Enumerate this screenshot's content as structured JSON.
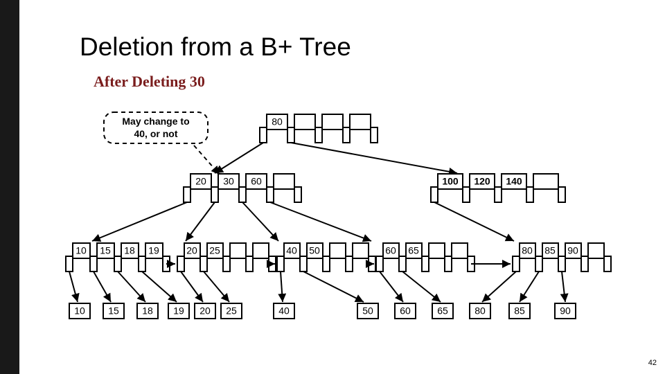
{
  "title": "Deletion from a B+ Tree",
  "subtitle": "After Deleting 30",
  "page_number": "42",
  "callout": {
    "line1": "May change to",
    "line2": "40, or not"
  },
  "root": {
    "keys": [
      "80",
      "",
      "",
      ""
    ]
  },
  "internal_left": {
    "keys": [
      "20",
      "30",
      "60",
      ""
    ]
  },
  "internal_right": {
    "keys": [
      "100",
      "120",
      "140",
      ""
    ]
  },
  "leaves": [
    {
      "keys": [
        "10",
        "15",
        "18",
        "19"
      ]
    },
    {
      "keys": [
        "20",
        "25",
        "",
        ""
      ]
    },
    {
      "keys": [
        "40",
        "50",
        "",
        ""
      ]
    },
    {
      "keys": [
        "60",
        "65",
        "",
        ""
      ]
    },
    {
      "keys": [
        "80",
        "85",
        "90",
        ""
      ]
    }
  ],
  "records": [
    "10",
    "15",
    "18",
    "19",
    "20",
    "25",
    "40",
    "50",
    "60",
    "65",
    "80",
    "85",
    "90"
  ]
}
